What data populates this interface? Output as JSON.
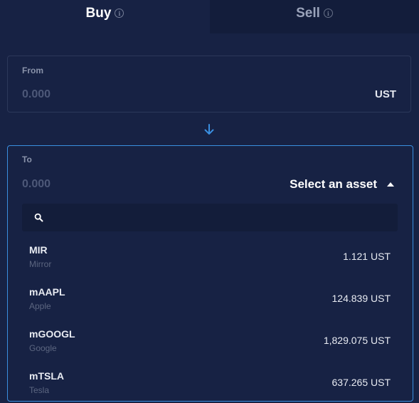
{
  "tabs": [
    {
      "label": "Buy",
      "info_icon": "info-icon",
      "active": true
    },
    {
      "label": "Sell",
      "info_icon": "info-icon",
      "active": false
    }
  ],
  "from": {
    "label": "From",
    "amount_placeholder": "0.000",
    "unit": "UST"
  },
  "swap_icon": "arrow-down-icon",
  "to": {
    "label": "To",
    "amount_placeholder": "0.000",
    "select_label": "Select an asset",
    "select_icon": "caret-up-icon",
    "search": {
      "icon": "search-icon",
      "value": "",
      "placeholder": ""
    },
    "assets": [
      {
        "symbol": "MIR",
        "name": "Mirror",
        "price": "1.121 UST"
      },
      {
        "symbol": "mAAPL",
        "name": "Apple",
        "price": "124.839 UST"
      },
      {
        "symbol": "mGOOGL",
        "name": "Google",
        "price": "1,829.075 UST"
      },
      {
        "symbol": "mTSLA",
        "name": "Tesla",
        "price": "637.265 UST"
      }
    ]
  },
  "colors": {
    "background": "#172244",
    "accent": "#3a8fe0",
    "inactive_tab": "#131d3b",
    "muted_text": "#8a93aa"
  }
}
